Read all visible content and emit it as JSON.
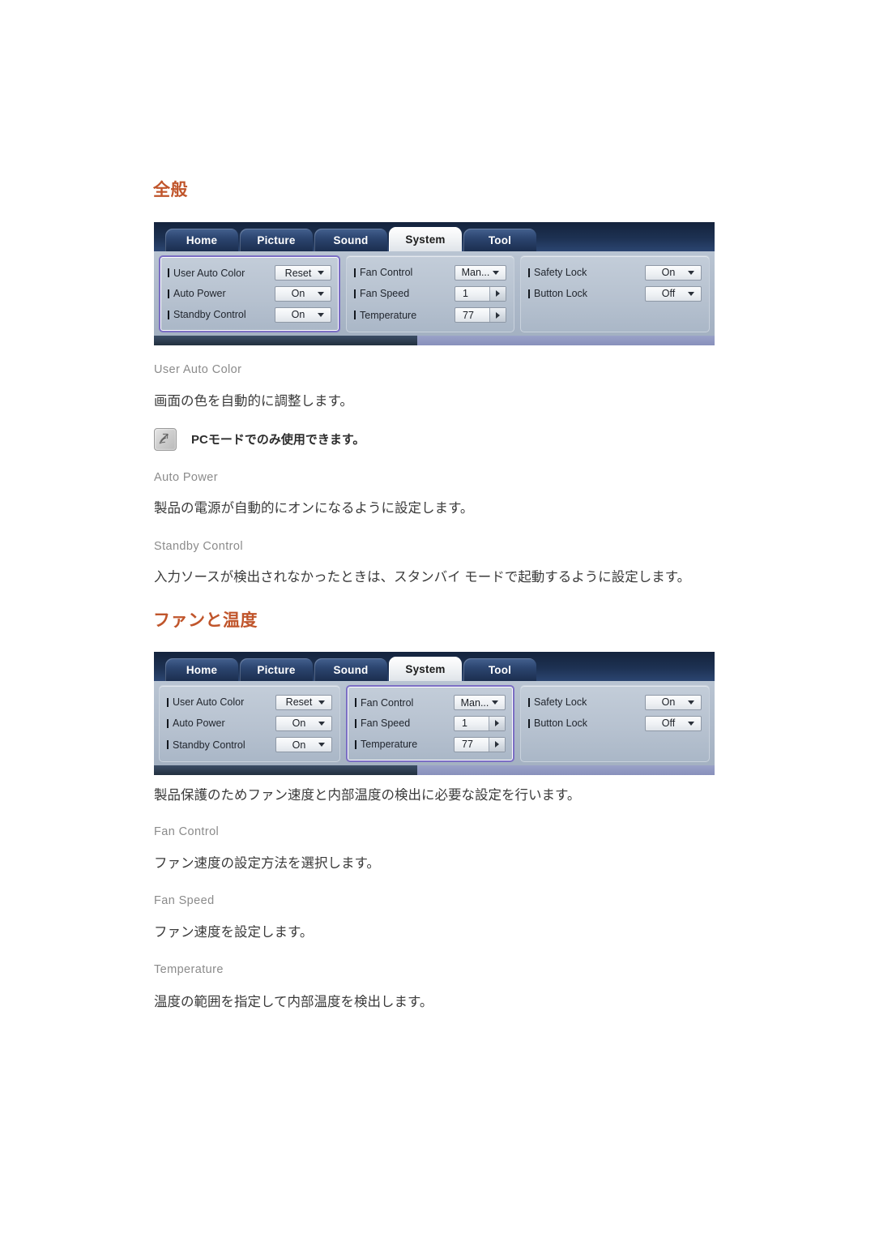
{
  "page": {
    "sections": [
      {
        "id": "general",
        "heading": "全般",
        "osd": {
          "tabs": [
            {
              "label": "Home",
              "active": false
            },
            {
              "label": "Picture",
              "active": false
            },
            {
              "label": "Sound",
              "active": false
            },
            {
              "label": "System",
              "active": true
            },
            {
              "label": "Tool",
              "active": false
            }
          ],
          "highlight_group": 0,
          "groups": [
            {
              "rows": [
                {
                  "label": "User Auto Color",
                  "value": "Reset",
                  "control": "dropdown"
                },
                {
                  "label": "Auto Power",
                  "value": "On",
                  "control": "dropdown"
                },
                {
                  "label": "Standby Control",
                  "value": "On",
                  "control": "dropdown"
                }
              ]
            },
            {
              "rows": [
                {
                  "label": "Fan Control",
                  "value": "Man...",
                  "control": "dropdown"
                },
                {
                  "label": "Fan Speed",
                  "value": "1",
                  "control": "spinner"
                },
                {
                  "label": "Temperature",
                  "value": "77",
                  "control": "spinner"
                }
              ]
            },
            {
              "rows": [
                {
                  "label": "Safety Lock",
                  "value": "On",
                  "control": "dropdown"
                },
                {
                  "label": "Button Lock",
                  "value": "Off",
                  "control": "dropdown"
                }
              ]
            }
          ]
        },
        "items": [
          {
            "title": "User Auto Color",
            "desc": "画面の色を自動的に調整します。",
            "note": {
              "icon": "note-pen-icon",
              "text": "PCモードでのみ使用できます。"
            }
          },
          {
            "title": "Auto Power",
            "desc": "製品の電源が自動的にオンになるように設定します。"
          },
          {
            "title": "Standby Control",
            "desc": "入力ソースが検出されなかったときは、スタンバイ モードで起動するように設定します。"
          }
        ]
      },
      {
        "id": "fan-temperature",
        "heading": "ファンと温度",
        "osd": {
          "tabs": [
            {
              "label": "Home",
              "active": false
            },
            {
              "label": "Picture",
              "active": false
            },
            {
              "label": "Sound",
              "active": false
            },
            {
              "label": "System",
              "active": true
            },
            {
              "label": "Tool",
              "active": false
            }
          ],
          "highlight_group": 1,
          "groups": [
            {
              "rows": [
                {
                  "label": "User Auto Color",
                  "value": "Reset",
                  "control": "dropdown"
                },
                {
                  "label": "Auto Power",
                  "value": "On",
                  "control": "dropdown"
                },
                {
                  "label": "Standby Control",
                  "value": "On",
                  "control": "dropdown"
                }
              ]
            },
            {
              "rows": [
                {
                  "label": "Fan Control",
                  "value": "Man...",
                  "control": "dropdown"
                },
                {
                  "label": "Fan Speed",
                  "value": "1",
                  "control": "spinner"
                },
                {
                  "label": "Temperature",
                  "value": "77",
                  "control": "spinner"
                }
              ]
            },
            {
              "rows": [
                {
                  "label": "Safety Lock",
                  "value": "On",
                  "control": "dropdown"
                },
                {
                  "label": "Button Lock",
                  "value": "Off",
                  "control": "dropdown"
                }
              ]
            }
          ]
        },
        "intro": "製品保護のためファン速度と内部温度の検出に必要な設定を行います。",
        "items": [
          {
            "title": "Fan Control",
            "desc": "ファン速度の設定方法を選択します。"
          },
          {
            "title": "Fan Speed",
            "desc": "ファン速度を設定します。"
          },
          {
            "title": "Temperature",
            "desc": "温度の範囲を指定して内部温度を検出します。"
          }
        ]
      }
    ]
  },
  "colors": {
    "heading": "#C0552B",
    "sub_heading": "#8B8B8B",
    "body_text": "#3A3A3A",
    "osd_tabbar": "#1D3152",
    "osd_panel": "#AEBACA",
    "highlight_border": "#7B6EC4"
  }
}
